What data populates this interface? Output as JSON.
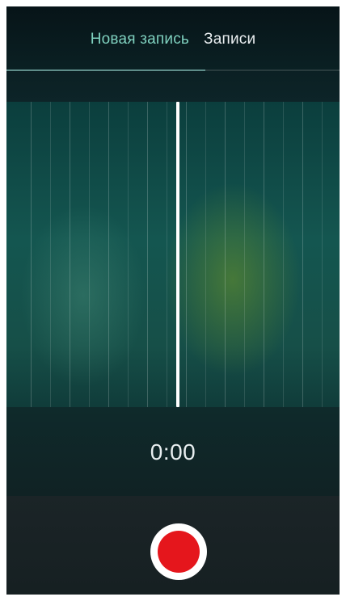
{
  "tabs": {
    "new_recording": "Новая запись",
    "recordings": "Записи"
  },
  "timer": {
    "elapsed": "0:00"
  },
  "controls": {
    "record_icon": "record-icon"
  },
  "colors": {
    "active_tab": "#7fd1bf",
    "record": "#e5161c"
  }
}
